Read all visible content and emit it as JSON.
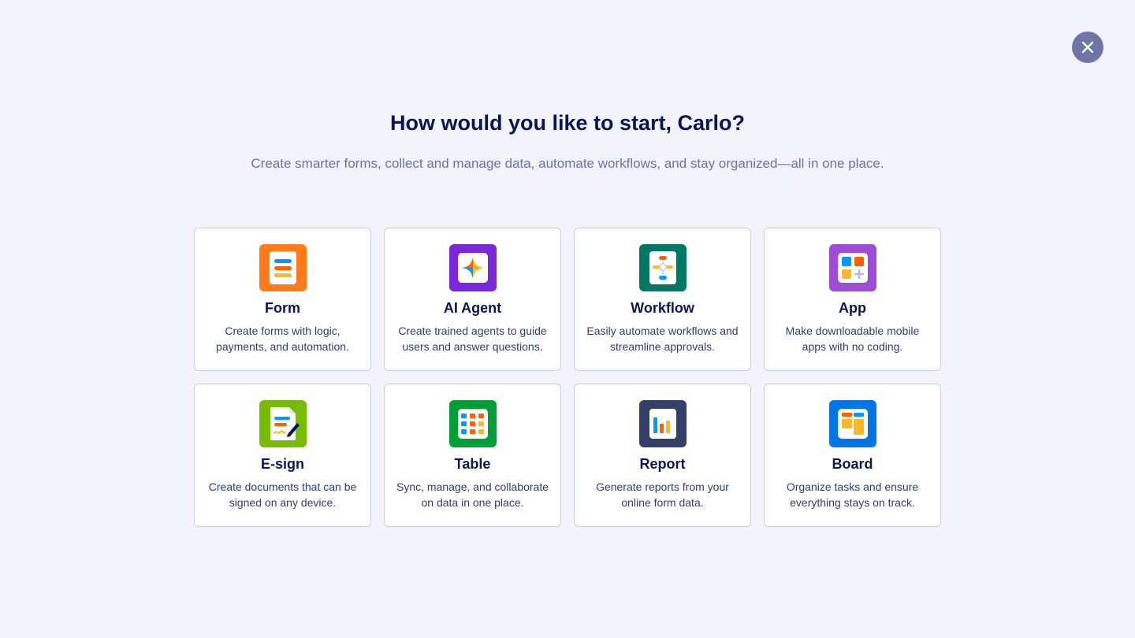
{
  "header": {
    "title": "How would you like to start, Carlo?",
    "subtitle": "Create smarter forms, collect and manage data, automate workflows, and stay organized—all in one place."
  },
  "colors": {
    "background": "#f2f3fb",
    "close_button": "#6f76a7",
    "title": "#0a1551",
    "subtitle": "#6c73a8"
  },
  "options": [
    {
      "title": "Form",
      "description": "Create forms with logic, payments, and automation.",
      "icon": "form-icon",
      "color": "#ff7b1c"
    },
    {
      "title": "AI Agent",
      "description": "Create trained agents to guide users and answer questions.",
      "icon": "ai-agent-icon",
      "color": "#7a26d9"
    },
    {
      "title": "Workflow",
      "description": "Easily automate workflows and streamline approvals.",
      "icon": "workflow-icon",
      "color": "#007862"
    },
    {
      "title": "App",
      "description": "Make downloadable mobile apps with no coding.",
      "icon": "app-icon",
      "color": "#9c4dd3"
    },
    {
      "title": "E-sign",
      "description": "Create documents that can be signed on any device.",
      "icon": "esign-icon",
      "color": "#78bb07"
    },
    {
      "title": "Table",
      "description": "Sync, manage, and collaborate on data in one place.",
      "icon": "table-icon",
      "color": "#049e38"
    },
    {
      "title": "Report",
      "description": "Generate reports from your online form data.",
      "icon": "report-icon",
      "color": "#344067"
    },
    {
      "title": "Board",
      "description": "Organize tasks and ensure everything stays on track.",
      "icon": "board-icon",
      "color": "#0075e3"
    }
  ]
}
